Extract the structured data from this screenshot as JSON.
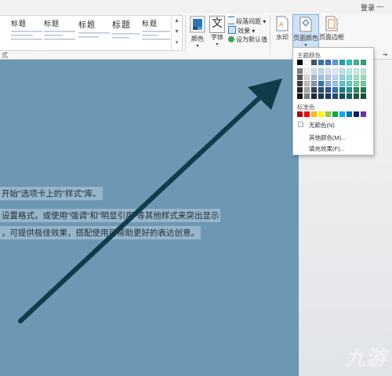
{
  "titlebar": {
    "login": "登录"
  },
  "ribbon": {
    "style_gallery": {
      "items": [
        {
          "label": "标题"
        },
        {
          "label": "标题"
        },
        {
          "label": "标题"
        },
        {
          "label": "标题"
        },
        {
          "label": "标题"
        }
      ]
    },
    "group_label": "式",
    "colors_label": "颜色",
    "fonts_label": "字体",
    "fonts_glyph": "文",
    "paragraph_spacing": "段落间距",
    "effects": "效果",
    "set_default": "设为默认值",
    "watermark_label": "水印",
    "page_color_label": "页面颜色",
    "page_border_label": "页面边框"
  },
  "dropdown": {
    "theme_colors_label": "主题颜色",
    "theme_top_row": [
      "#000000",
      "#ffffff",
      "#44546a",
      "#2e75b6",
      "#4472c4",
      "#5b9bd5",
      "#21a0b6",
      "#2ec4b6",
      "#3fb58a",
      "#3a9d6b"
    ],
    "theme_shades": [
      [
        "#7f7f7f",
        "#f2f2f2",
        "#d6dce4",
        "#bdd7ee",
        "#d9e2f3",
        "#deebf6",
        "#b4e4ec",
        "#b4ede6",
        "#c5ecd9",
        "#c1e5d1"
      ],
      [
        "#595959",
        "#d8d8d8",
        "#adb9ca",
        "#9cc3e5",
        "#b4c6e7",
        "#bdd7ee",
        "#8bd4e0",
        "#8adfd4",
        "#9fe0c0",
        "#9fd7b7"
      ],
      [
        "#3f3f3f",
        "#bfbfbf",
        "#8496b0",
        "#2e75b6",
        "#8eaadb",
        "#9dc3e6",
        "#5fc1d3",
        "#5ed0c0",
        "#78d3a6",
        "#7bc79c"
      ],
      [
        "#262626",
        "#a5a5a5",
        "#323f4f",
        "#1f4e79",
        "#2f5496",
        "#2e75b6",
        "#187a8a",
        "#1f9487",
        "#2c8a64",
        "#2b7550"
      ],
      [
        "#0c0c0c",
        "#7f7f7f",
        "#222a35",
        "#16375a",
        "#1f3864",
        "#1f4e79",
        "#10525c",
        "#14635a",
        "#1d5c43",
        "#1c4e35"
      ]
    ],
    "standard_colors_label": "标准色",
    "standard_colors": [
      "#c00000",
      "#ff0000",
      "#ffc000",
      "#ffff00",
      "#92d050",
      "#00b050",
      "#00b0f0",
      "#0070c0",
      "#002060",
      "#7030a0"
    ],
    "no_color": "无颜色(N)",
    "more_colors": "其他颜色(M)...",
    "fill_effects": "填充效果(F)..."
  },
  "document": {
    "lines": [
      "开始\"选项卡上的\"样式\"库。",
      "设置格式，或使用\"强调\"和\"明显引用\"等其他样式来突出显示",
      "，可提供极佳效果，搭配使用可帮助更好的表达创意。"
    ]
  },
  "watermark_text": "九游",
  "colors": {
    "page_background": "#6d98b4",
    "arrow": "#0f3c48"
  }
}
